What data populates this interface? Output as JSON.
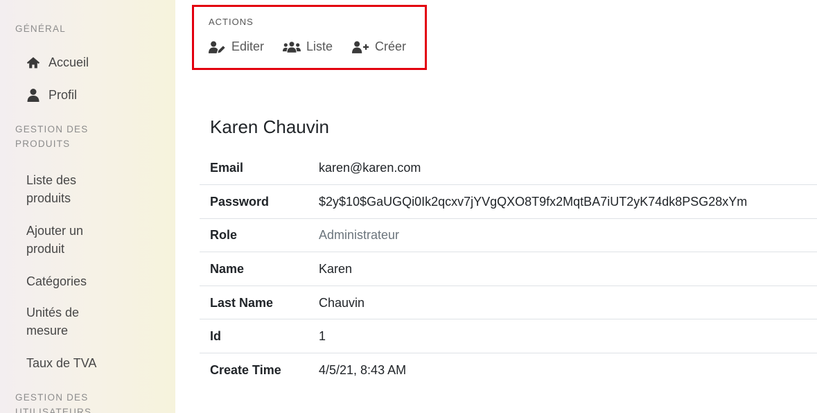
{
  "sidebar": {
    "sections": [
      {
        "title": "GÉNÉRAL"
      },
      {
        "title_line1": "GESTION DES",
        "title_line2": "PRODUITS"
      },
      {
        "title_line1": "GESTION DES",
        "title_line2": "UTILISATEURS"
      }
    ],
    "items": [
      {
        "label": "Accueil",
        "icon": "home-icon"
      },
      {
        "label": "Profil",
        "icon": "user-icon"
      },
      {
        "label_line1": "Liste des",
        "label_line2": "produits"
      },
      {
        "label_line1": "Ajouter un",
        "label_line2": "produit"
      },
      {
        "label": "Catégories"
      },
      {
        "label_line1": "Unités de",
        "label_line2": "mesure"
      },
      {
        "label": "Taux de TVA"
      }
    ]
  },
  "actions": {
    "title": "ACTIONS",
    "items": [
      {
        "label": "Editer",
        "icon": "user-edit-icon"
      },
      {
        "label": "Liste",
        "icon": "users-icon"
      },
      {
        "label": "Créer",
        "icon": "user-plus-icon"
      }
    ],
    "highlight_color": "#e3000f"
  },
  "user": {
    "full_name": "Karen Chauvin",
    "fields": [
      {
        "key": "Email",
        "value": "karen@karen.com"
      },
      {
        "key": "Password",
        "value": "$2y$10$GaUGQi0Ik2qcxv7jYVgQXO8T9fx2MqtBA7iUT2yK74dk8PSG28xYm"
      },
      {
        "key": "Role",
        "value": "Administrateur"
      },
      {
        "key": "Name",
        "value": "Karen"
      },
      {
        "key": "Last Name",
        "value": "Chauvin"
      },
      {
        "key": "Id",
        "value": "1"
      },
      {
        "key": "Create Time",
        "value": "4/5/21, 8:43 AM"
      }
    ]
  }
}
